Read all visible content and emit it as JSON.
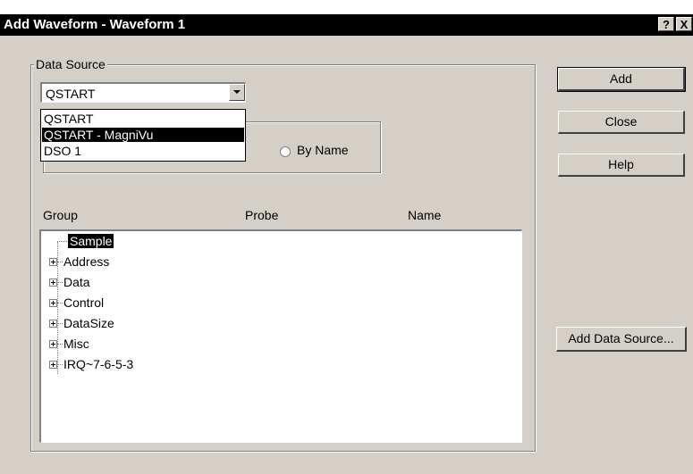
{
  "window": {
    "title": "Add Waveform - Waveform 1",
    "help_glyph": "?",
    "close_glyph": "X"
  },
  "data_source": {
    "legend": "Data Source",
    "selected": "QSTART",
    "options": [
      "QSTART",
      "QSTART - MagniVu",
      "DSO 1"
    ],
    "highlighted_option": "QSTART - MagniVu",
    "by_name_label": "By Name"
  },
  "columns": {
    "group": "Group",
    "probe": "Probe",
    "name": "Name"
  },
  "tree": {
    "items": [
      {
        "label": "Sample",
        "selected": true,
        "expandable": false
      },
      {
        "label": "Address",
        "selected": false,
        "expandable": true
      },
      {
        "label": "Data",
        "selected": false,
        "expandable": true
      },
      {
        "label": "Control",
        "selected": false,
        "expandable": true
      },
      {
        "label": "DataSize",
        "selected": false,
        "expandable": true
      },
      {
        "label": "Misc",
        "selected": false,
        "expandable": true
      },
      {
        "label": "IRQ~7-6-5-3",
        "selected": false,
        "expandable": true
      }
    ]
  },
  "buttons": {
    "add": "Add",
    "close": "Close",
    "help": "Help",
    "add_data_source": "Add Data Source..."
  }
}
